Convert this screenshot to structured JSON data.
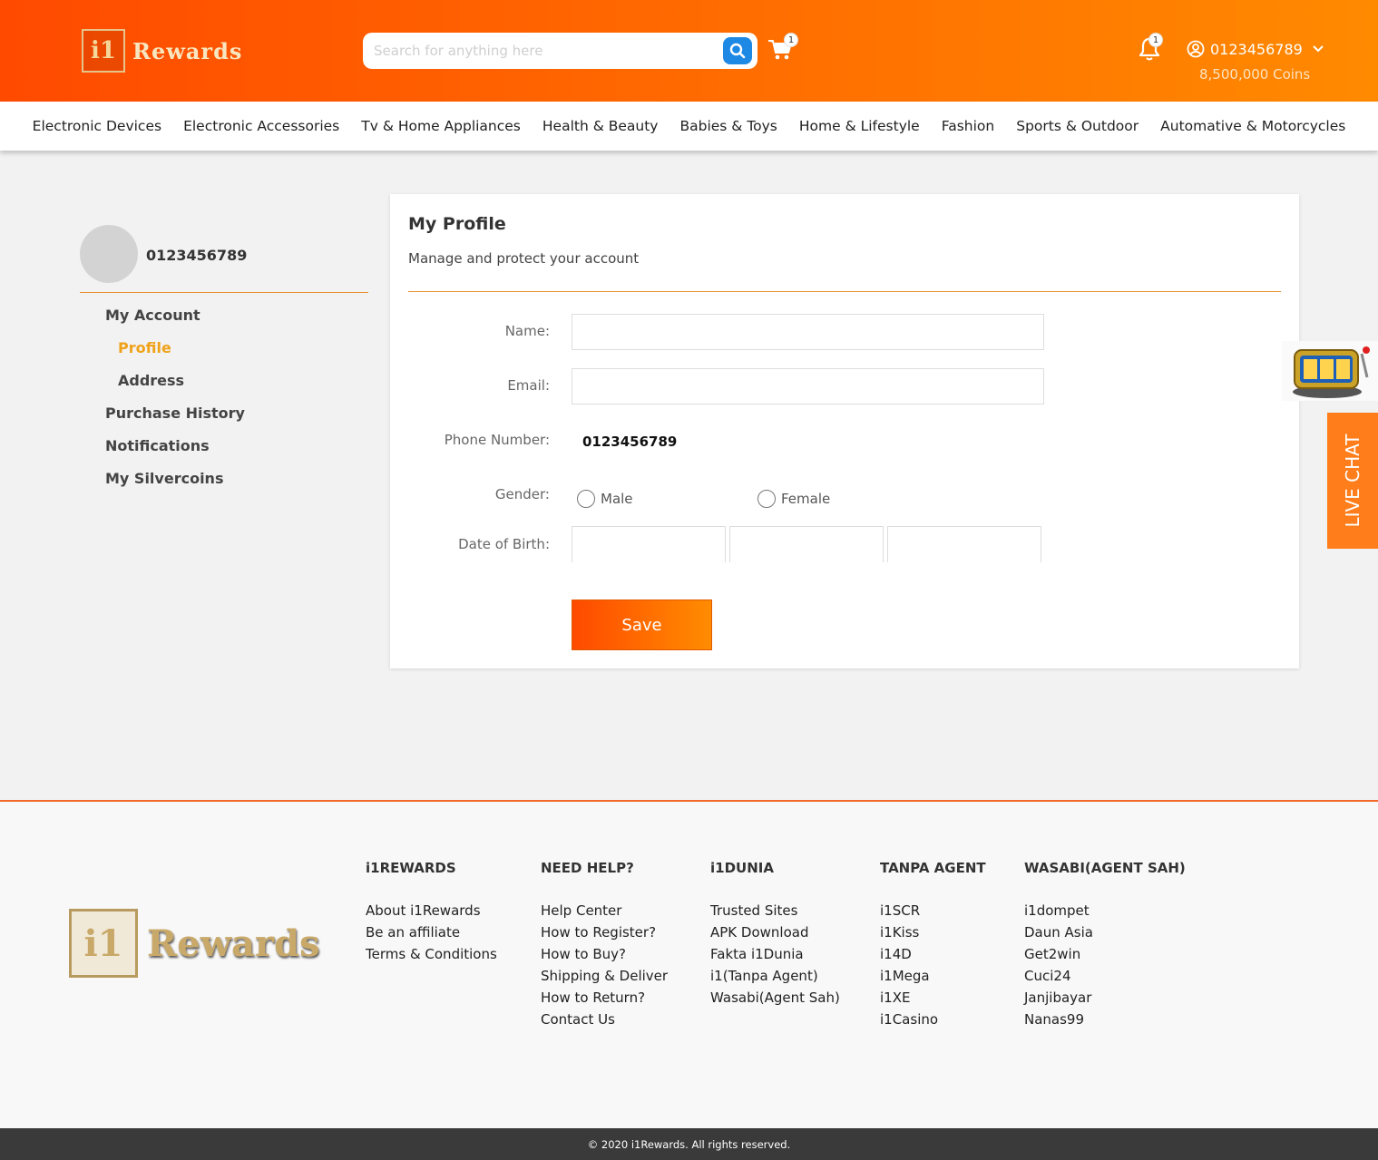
{
  "header": {
    "logo_mark": "i1",
    "logo_text": "Rewards",
    "search_placeholder": "Search for anything here",
    "cart_count": "1",
    "notification_count": "1",
    "user_id": "0123456789",
    "coins": "8,500,000 Coins"
  },
  "categories": [
    "Electronic Devices",
    "Electronic Accessories",
    "Tv & Home Appliances",
    "Health & Beauty",
    "Babies & Toys",
    "Home & Lifestyle",
    "Fashion",
    "Sports & Outdoor",
    "Automative & Motorcycles"
  ],
  "sidebar": {
    "username": "0123456789",
    "menu": {
      "my_account": "My Account",
      "profile": "Profile",
      "address": "Address",
      "purchase_history": "Purchase History",
      "notifications": "Notifications",
      "my_silvercoins": "My Silvercoins"
    }
  },
  "profile": {
    "title": "My Profile",
    "subtitle": "Manage and protect your account",
    "name_label": "Name:",
    "name_value": "",
    "email_label": "Email:",
    "email_value": "",
    "phone_label": "Phone Number:",
    "phone_value": "0123456789",
    "gender_label": "Gender:",
    "gender_male": "Male",
    "gender_female": "Female",
    "dob_label": "Date of Birth:",
    "save_label": "Save"
  },
  "widgets": {
    "live_chat": "LIVE CHAT"
  },
  "footer": {
    "logo_mark": "i1",
    "logo_text": "Rewards",
    "columns": [
      {
        "heading": "i1REWARDS",
        "links": [
          "About i1Rewards",
          "Be an affiliate",
          "Terms & Conditions"
        ]
      },
      {
        "heading": "NEED HELP?",
        "links": [
          "Help Center",
          "How to Register?",
          "How to Buy?",
          "Shipping & Deliver",
          "How to Return?",
          "Contact Us"
        ]
      },
      {
        "heading": "i1DUNIA",
        "links": [
          "Trusted Sites",
          "APK Download",
          "Fakta i1Dunia",
          "i1(Tanpa Agent)",
          "Wasabi(Agent Sah)"
        ]
      },
      {
        "heading": "TANPA AGENT",
        "links": [
          "i1SCR",
          "i1Kiss",
          "i14D",
          "i1Mega",
          "i1XE",
          "i1Casino"
        ]
      },
      {
        "heading": "WASABI(AGENT SAH)",
        "links": [
          "i1dompet",
          "Daun Asia",
          "Get2win",
          "Cuci24",
          "Janjibayar",
          "Nanas99"
        ]
      }
    ],
    "copyright": "© 2020 i1Rewards. All rights reserved."
  },
  "colors": {
    "brand_orange": "#ff6a00",
    "accent": "#f0a21a",
    "search_button": "#1e88e5"
  }
}
